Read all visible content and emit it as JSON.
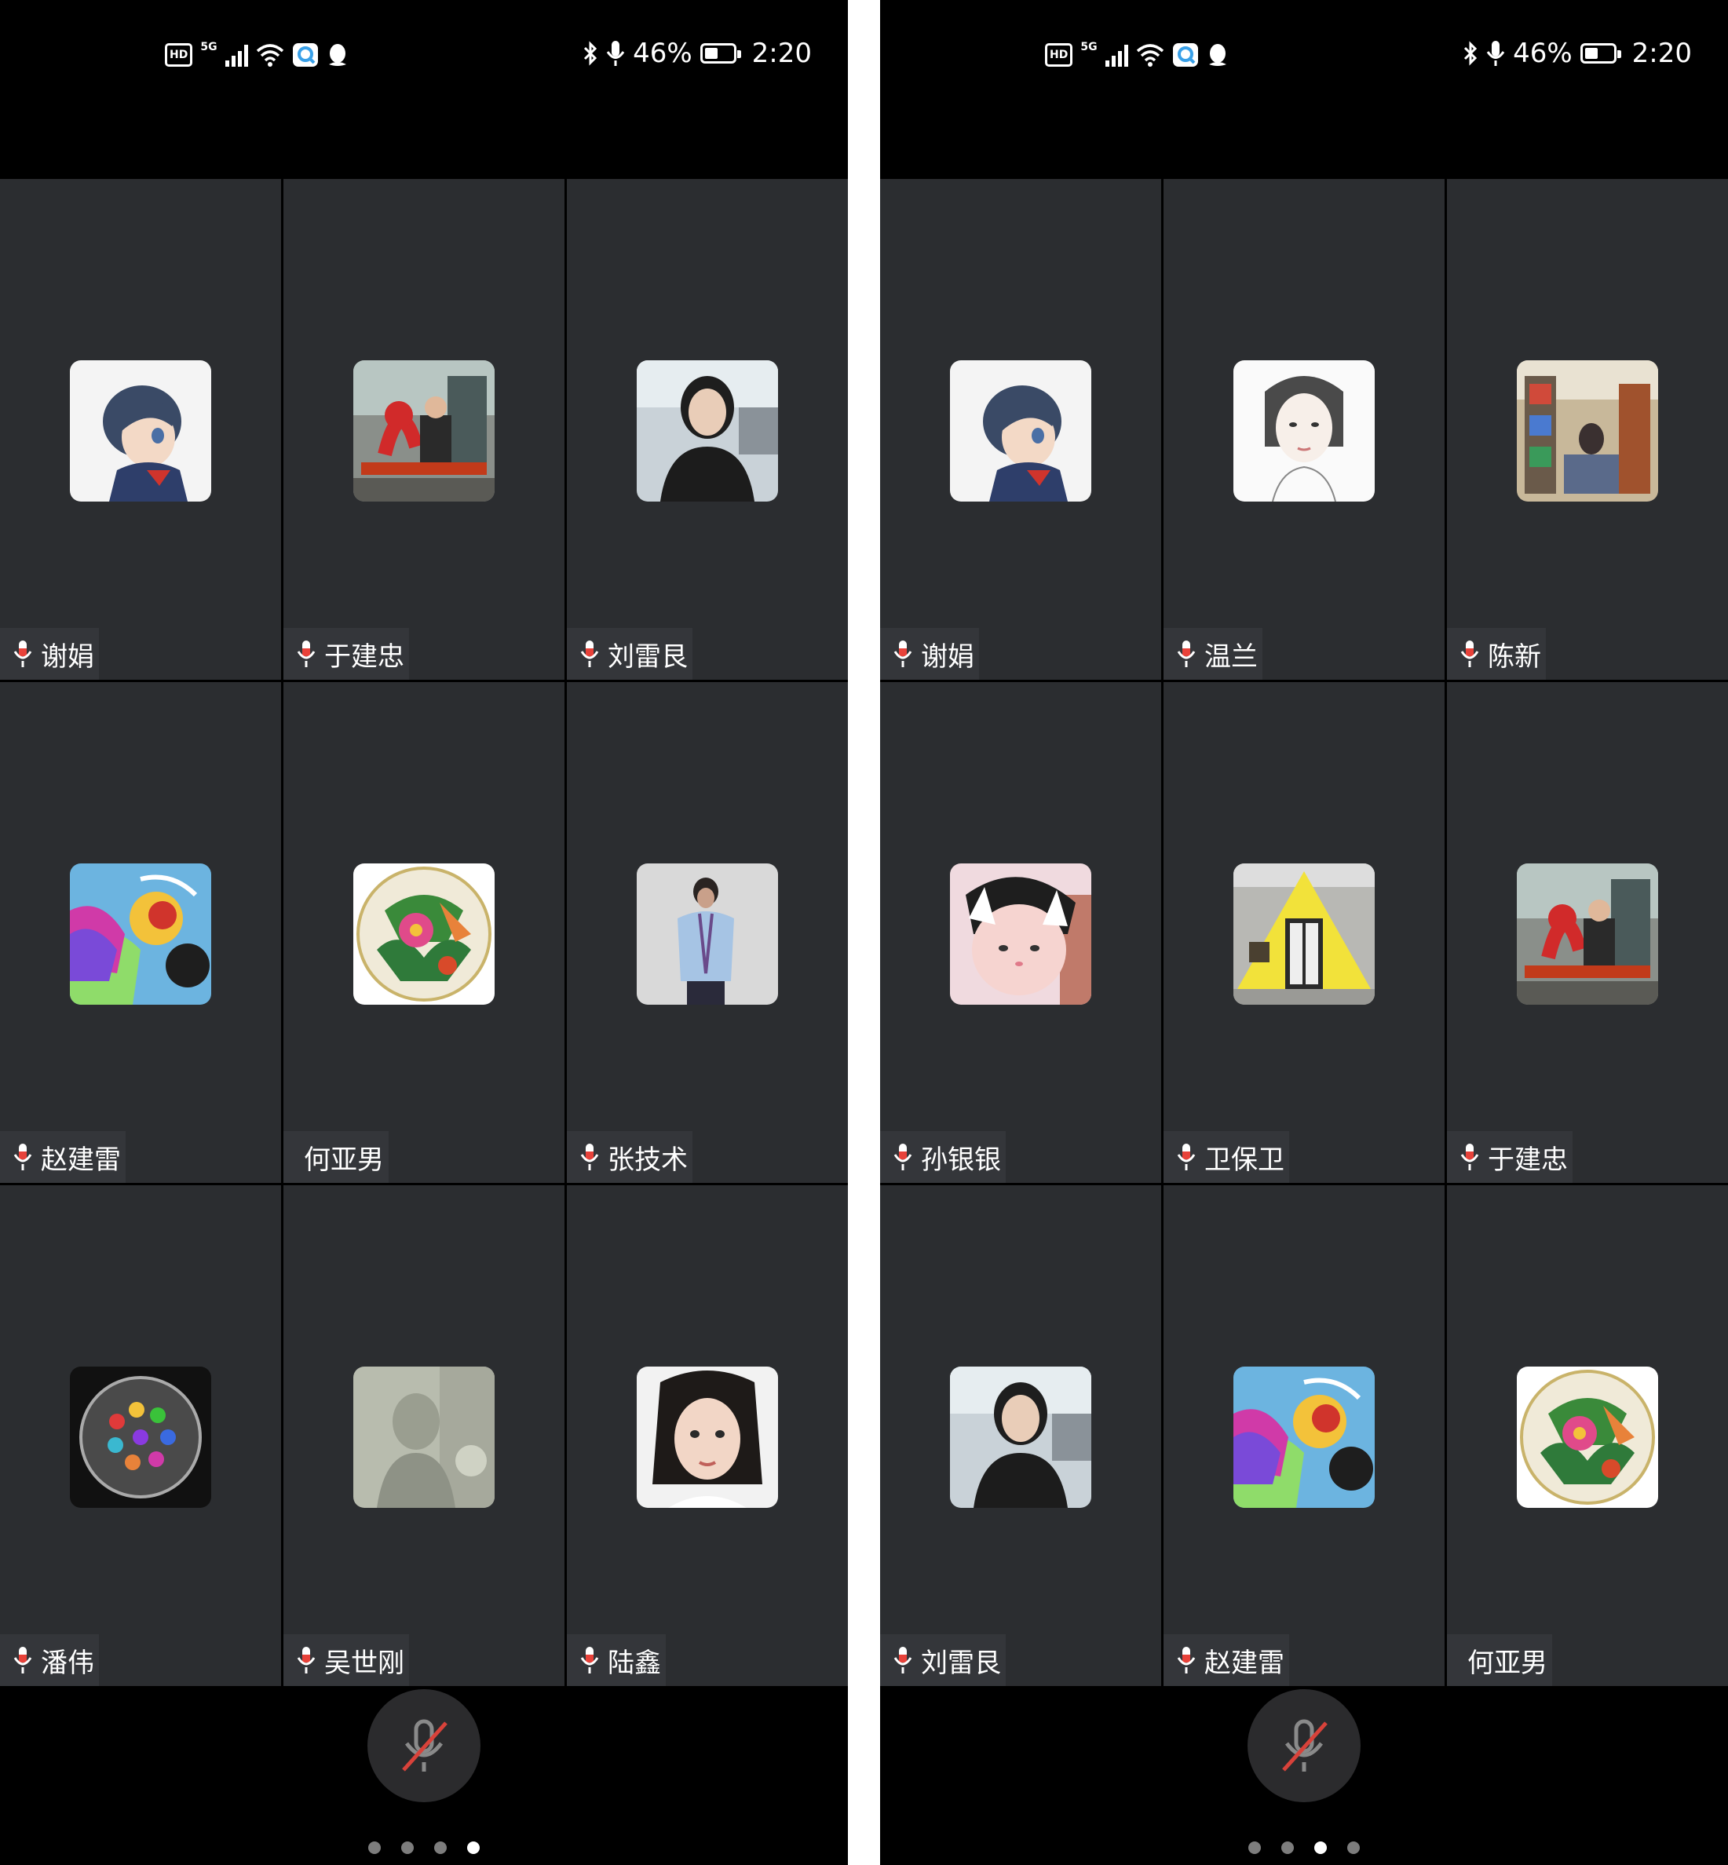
{
  "colors": {
    "tile_bg": "#2b2d30",
    "name_chip_bg": "#34363a",
    "mic_red": "#e8423a",
    "dot_inactive": "#7d7d7d",
    "dot_active": "#ffffff"
  },
  "phones": [
    {
      "status": {
        "left_icons": [
          "hd-icon",
          "5g-signal-icon",
          "wifi-icon",
          "app-notification-icon",
          "qq-icon"
        ],
        "battery": "46%",
        "time": "2:20"
      },
      "participants": [
        {
          "name": "谢娟",
          "mic": true,
          "avatar": "anime-girl"
        },
        {
          "name": "于建忠",
          "mic": true,
          "avatar": "man-bench"
        },
        {
          "name": "刘雷艮",
          "mic": true,
          "avatar": "woman-office"
        },
        {
          "name": "赵建雷",
          "mic": true,
          "avatar": "monkey-king"
        },
        {
          "name": "何亚男",
          "mic": false,
          "avatar": "tropical-plate"
        },
        {
          "name": "张技术",
          "mic": true,
          "avatar": "child-photo"
        },
        {
          "name": "潘伟",
          "mic": true,
          "avatar": "crayon-box"
        },
        {
          "name": "吴世刚",
          "mic": true,
          "avatar": "faded-portrait"
        },
        {
          "name": "陆鑫",
          "mic": true,
          "avatar": "woman-portrait"
        }
      ],
      "page_dots": {
        "count": 4,
        "active": 3
      }
    },
    {
      "status": {
        "left_icons": [
          "hd-icon",
          "5g-signal-icon",
          "wifi-icon",
          "app-notification-icon",
          "qq-icon"
        ],
        "battery": "46%",
        "time": "2:20"
      },
      "participants": [
        {
          "name": "谢娟",
          "mic": true,
          "avatar": "anime-girl"
        },
        {
          "name": "温兰",
          "mic": true,
          "avatar": "sketch-girl"
        },
        {
          "name": "陈新",
          "mic": true,
          "avatar": "shelf-photo"
        },
        {
          "name": "孙银银",
          "mic": true,
          "avatar": "baby-cat"
        },
        {
          "name": "卫保卫",
          "mic": true,
          "avatar": "yellow-house"
        },
        {
          "name": "于建忠",
          "mic": true,
          "avatar": "man-bench"
        },
        {
          "name": "刘雷艮",
          "mic": true,
          "avatar": "woman-office"
        },
        {
          "name": "赵建雷",
          "mic": true,
          "avatar": "monkey-king"
        },
        {
          "name": "何亚男",
          "mic": false,
          "avatar": "tropical-plate"
        }
      ],
      "page_dots": {
        "count": 4,
        "active": 2
      }
    }
  ],
  "controls": {
    "mute_button": "microphone-muted-icon"
  }
}
